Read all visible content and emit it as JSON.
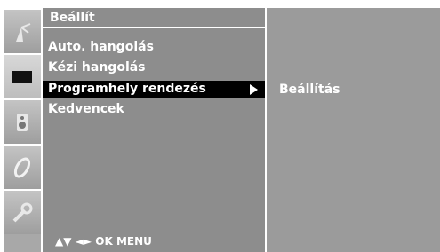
{
  "menu": {
    "title": "Beállít",
    "items": [
      {
        "label": "Auto. hangolás"
      },
      {
        "label": "Kézi hangolás"
      },
      {
        "label": "Programhely rendezés"
      },
      {
        "label": "Kedvencek"
      }
    ],
    "selected_index": 2,
    "nav_hint": "▲▼ ◄► OK  MENU"
  },
  "submenu": {
    "items": [
      {
        "label": "Beállítás"
      }
    ]
  },
  "icons": [
    "antenna-icon",
    "screen-icon",
    "speaker-icon",
    "clock-icon",
    "wrench-icon"
  ],
  "colors": {
    "menu_bg": "#8d8d8d",
    "submenu_bg": "#9b9b9b",
    "icon_column_bg": "#a8a8a8",
    "selected_bg": "#000000",
    "text": "#ffffff"
  }
}
